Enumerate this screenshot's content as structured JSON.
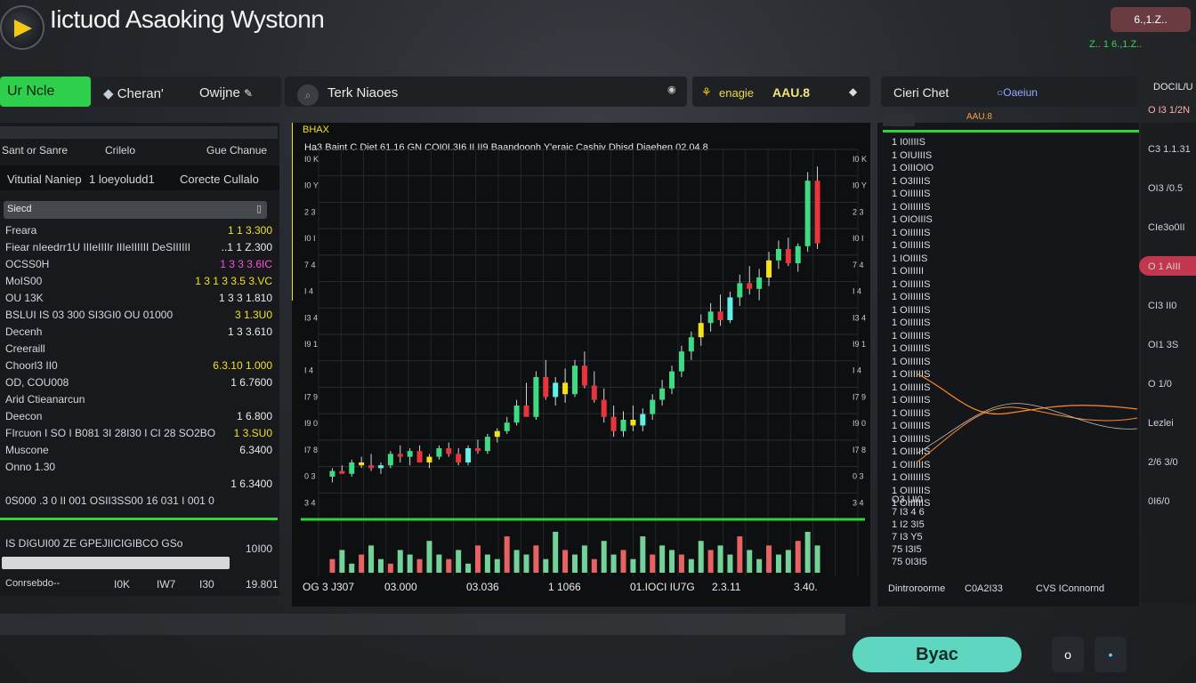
{
  "header": {
    "title": "Iictuod Asaoking Wystonn",
    "badge": "6.,1.Z..",
    "sub_text": "Z.. 1 6.,1.Z..",
    "logo_icon": "play-logo-icon"
  },
  "tabs": {
    "active": "Ur Ncle",
    "items": [
      "Cheran'",
      "Owijne"
    ]
  },
  "chart_header": {
    "title": "Terk Niaoes",
    "pair_label": "enagie",
    "pair_value": "AAU.8",
    "right_title": "Cieri Chet",
    "right_sub": "Oaeiun"
  },
  "left_panel": {
    "col_headers": [
      "Sant or Sanre",
      "Crilelo",
      "Gue Chanue"
    ],
    "subheader": [
      "Vitutial Naniep",
      "1 loeyoludd1",
      "Corecte Cullalo"
    ],
    "search_placeholder": "Siecd",
    "rows": [
      {
        "label": "Freara",
        "value": "1 1 3.300"
      },
      {
        "label": "Fiear  nIeedrr1U  IIIeIIIIr  IIIeIIIIII  DeSIIIIII",
        "value": "..1 1 Z.300"
      },
      {
        "label": "OCSS0H",
        "value": "1 3 3 3.6IC"
      },
      {
        "label": "MoIS00",
        "value": "1 3 1 3 3.5 3.VC"
      },
      {
        "label": "OU 13K",
        "value": "1 3 3 1.810"
      },
      {
        "label": "BSLUI IS 03 300   SI3GI0   OU   01000",
        "value": "3 1.3U0"
      },
      {
        "label": "Decenh",
        "value": "1 3 3.610"
      },
      {
        "label": "Creeraill",
        "value": ""
      },
      {
        "label": "Choorl3 II0",
        "value": "6.3.10 1.000"
      },
      {
        "label": "OD, COU008",
        "value": "1 6.7600"
      },
      {
        "label": "Arid Ctieanarcun",
        "value": ""
      },
      {
        "label": "Deecon",
        "value": "1 6.800"
      },
      {
        "label": "FIrcuon  I SO  I B081  3I 28I30  I CI 28  SO2BO",
        "value": "1 3.SU0"
      },
      {
        "label": "Muscone",
        "value": "6.3400"
      },
      {
        "label": "Onno 1.30",
        "value": ""
      },
      {
        "label": "",
        "value": "1 6.3400"
      },
      {
        "label": "0S000 .3 0  II 001  OSII3SS00  16 031  I 001 0",
        "value": ""
      }
    ],
    "footer_row": "IS DIGUI00 ZE GPEJIICIGIBCO  GSo",
    "footer_value": "10I00",
    "bottom_left": "Conrsebdo--",
    "bottom_cols": [
      "I0K",
      "IW7",
      "I30",
      "19.801"
    ]
  },
  "chart": {
    "top_label": "BHAX",
    "legend_line": "Ha3 Baint C Diet 61.16   GN   COI0I.3I6   II II9   Baandoonh Y'eraic Cashiv   Dhisd Diaehen 02.04.8",
    "x_labels": [
      "OG 3 J307",
      "03.000",
      "03.036",
      "1 1066",
      "01.IOCI IU7G",
      "2.3.11",
      "3.40."
    ],
    "y_labels": [
      "I0 K",
      "I0 Y",
      "2 3",
      "I0 I",
      "7 4",
      "I 4",
      "I3 4",
      "I9 1",
      "I 4",
      "I7 9",
      "I9 0",
      "I7 8",
      "0 3",
      "3 4"
    ]
  },
  "chart_data": {
    "type": "candlestick",
    "candles": [
      [
        1.5,
        1.8,
        1.3,
        1.7
      ],
      [
        1.7,
        1.9,
        1.6,
        1.6
      ],
      [
        1.6,
        2.1,
        1.5,
        2.0
      ],
      [
        2.0,
        2.2,
        1.8,
        1.9
      ],
      [
        1.9,
        2.3,
        1.7,
        1.8
      ],
      [
        1.8,
        2.0,
        1.6,
        1.9
      ],
      [
        1.9,
        2.4,
        1.8,
        2.3
      ],
      [
        2.3,
        2.6,
        2.0,
        2.2
      ],
      [
        2.2,
        2.5,
        1.9,
        2.4
      ],
      [
        2.4,
        2.6,
        2.1,
        2.0
      ],
      [
        2.0,
        2.3,
        1.8,
        2.2
      ],
      [
        2.2,
        2.6,
        2.1,
        2.5
      ],
      [
        2.5,
        2.7,
        2.2,
        2.3
      ],
      [
        2.3,
        2.5,
        1.9,
        2.0
      ],
      [
        2.0,
        2.6,
        1.9,
        2.5
      ],
      [
        2.5,
        2.8,
        2.3,
        2.4
      ],
      [
        2.4,
        3.0,
        2.3,
        2.9
      ],
      [
        2.9,
        3.2,
        2.7,
        3.1
      ],
      [
        3.1,
        3.6,
        3.0,
        3.4
      ],
      [
        3.4,
        4.2,
        3.3,
        4.0
      ],
      [
        4.0,
        4.8,
        3.9,
        3.6
      ],
      [
        3.6,
        5.2,
        3.5,
        5.0
      ],
      [
        5.0,
        5.6,
        4.2,
        4.3
      ],
      [
        4.3,
        5.0,
        4.0,
        4.8
      ],
      [
        4.8,
        5.3,
        4.1,
        4.4
      ],
      [
        4.4,
        5.6,
        4.3,
        5.4
      ],
      [
        5.4,
        5.9,
        4.6,
        4.7
      ],
      [
        4.7,
        5.2,
        4.1,
        4.2
      ],
      [
        4.2,
        4.6,
        3.4,
        3.6
      ],
      [
        3.6,
        4.0,
        2.9,
        3.1
      ],
      [
        3.1,
        3.8,
        2.9,
        3.5
      ],
      [
        3.5,
        4.0,
        3.1,
        3.3
      ],
      [
        3.3,
        3.9,
        3.1,
        3.7
      ],
      [
        3.7,
        4.4,
        3.5,
        4.2
      ],
      [
        4.2,
        4.9,
        4.0,
        4.6
      ],
      [
        4.6,
        5.4,
        4.4,
        5.2
      ],
      [
        5.2,
        6.1,
        5.0,
        5.9
      ],
      [
        5.9,
        6.6,
        5.6,
        6.4
      ],
      [
        6.4,
        7.2,
        6.1,
        6.9
      ],
      [
        6.9,
        7.6,
        6.6,
        7.3
      ],
      [
        7.3,
        7.9,
        6.8,
        7.0
      ],
      [
        7.0,
        8.0,
        6.9,
        7.8
      ],
      [
        7.8,
        8.6,
        7.5,
        8.3
      ],
      [
        8.3,
        8.9,
        7.9,
        8.1
      ],
      [
        8.1,
        8.8,
        7.7,
        8.5
      ],
      [
        8.5,
        9.4,
        8.2,
        9.1
      ],
      [
        9.1,
        9.8,
        8.8,
        9.5
      ],
      [
        9.5,
        9.9,
        8.9,
        9.0
      ],
      [
        9.0,
        9.7,
        8.7,
        9.6
      ],
      [
        9.6,
        12.2,
        9.4,
        11.9
      ],
      [
        11.9,
        12.4,
        9.5,
        9.7
      ]
    ],
    "volumes": [
      3,
      5,
      2,
      4,
      6,
      3,
      2,
      5,
      4,
      3,
      7,
      4,
      3,
      5,
      2,
      6,
      4,
      3,
      8,
      5,
      4,
      6,
      3,
      9,
      5,
      4,
      6,
      3,
      7,
      4,
      5,
      3,
      8,
      4,
      6,
      5,
      4,
      3,
      7,
      5,
      6,
      4,
      8,
      5,
      3,
      6,
      4,
      5,
      7,
      9,
      6
    ],
    "ylim": [
      0,
      13
    ],
    "colors": {
      "up": "#3ddc84",
      "down": "#e8343b",
      "alt": "#f5e11a",
      "cyan": "#5ff2e8"
    }
  },
  "order_book": {
    "title_icon": "orderbook-icon",
    "rows": [
      "1 I0IIIIS",
      "1 OIUIIIS",
      "1 OIIIOIO",
      "1 O3IIIIS",
      "1 OIIIIIIS",
      "1 OIIIIIIS",
      "1 OIOIIIS",
      "1 OIIIIIIS",
      "1 OIIIIIIS",
      "1 IOIIIIS",
      "1 OIIIIII",
      "1 OIIIIIIS",
      "1 OIIIIIIS",
      "1 OIIIIIIS",
      "1 OIIIIIIS",
      "1 OIIIIIIS",
      "1 OIIIIIIS",
      "1 OIIIIIIS",
      "1 OIIIIIIS",
      "1 OIIIIIIS",
      "1 OIIIIIIS",
      "1 OIIIIIIS",
      "1 OIIIIIIS",
      "1 OIIIIIIS",
      "1 OIIIIIIS",
      "1 OIIIIIIS",
      "1 OIIIIIIS",
      "1 OIIIIIIS",
      "1 OIIIIIIS"
    ],
    "lower_rows": [
      "O3 UI0",
      "7 I3 4 6",
      "1 I2 3I5",
      "7 I3 Y5",
      "75 I3I5",
      "75 0I3I5"
    ],
    "footer": [
      "Dintroroorme",
      "C0A2I33",
      "CVS IConnornd"
    ]
  },
  "far_panel": {
    "title": "DOCIL/U",
    "items": [
      "O I3 1/2N",
      "C3 1.1.31",
      "OI3 /0.5",
      "CIe3o0II",
      "O 1 AIII",
      "CI3 II0",
      "OI1 3S",
      "O 1/0",
      "Lezlei",
      "2/6 3/0",
      "0I6/0"
    ]
  },
  "footer": {
    "sync_label": "Byac",
    "icon1": "o",
    "icon2": "•"
  }
}
